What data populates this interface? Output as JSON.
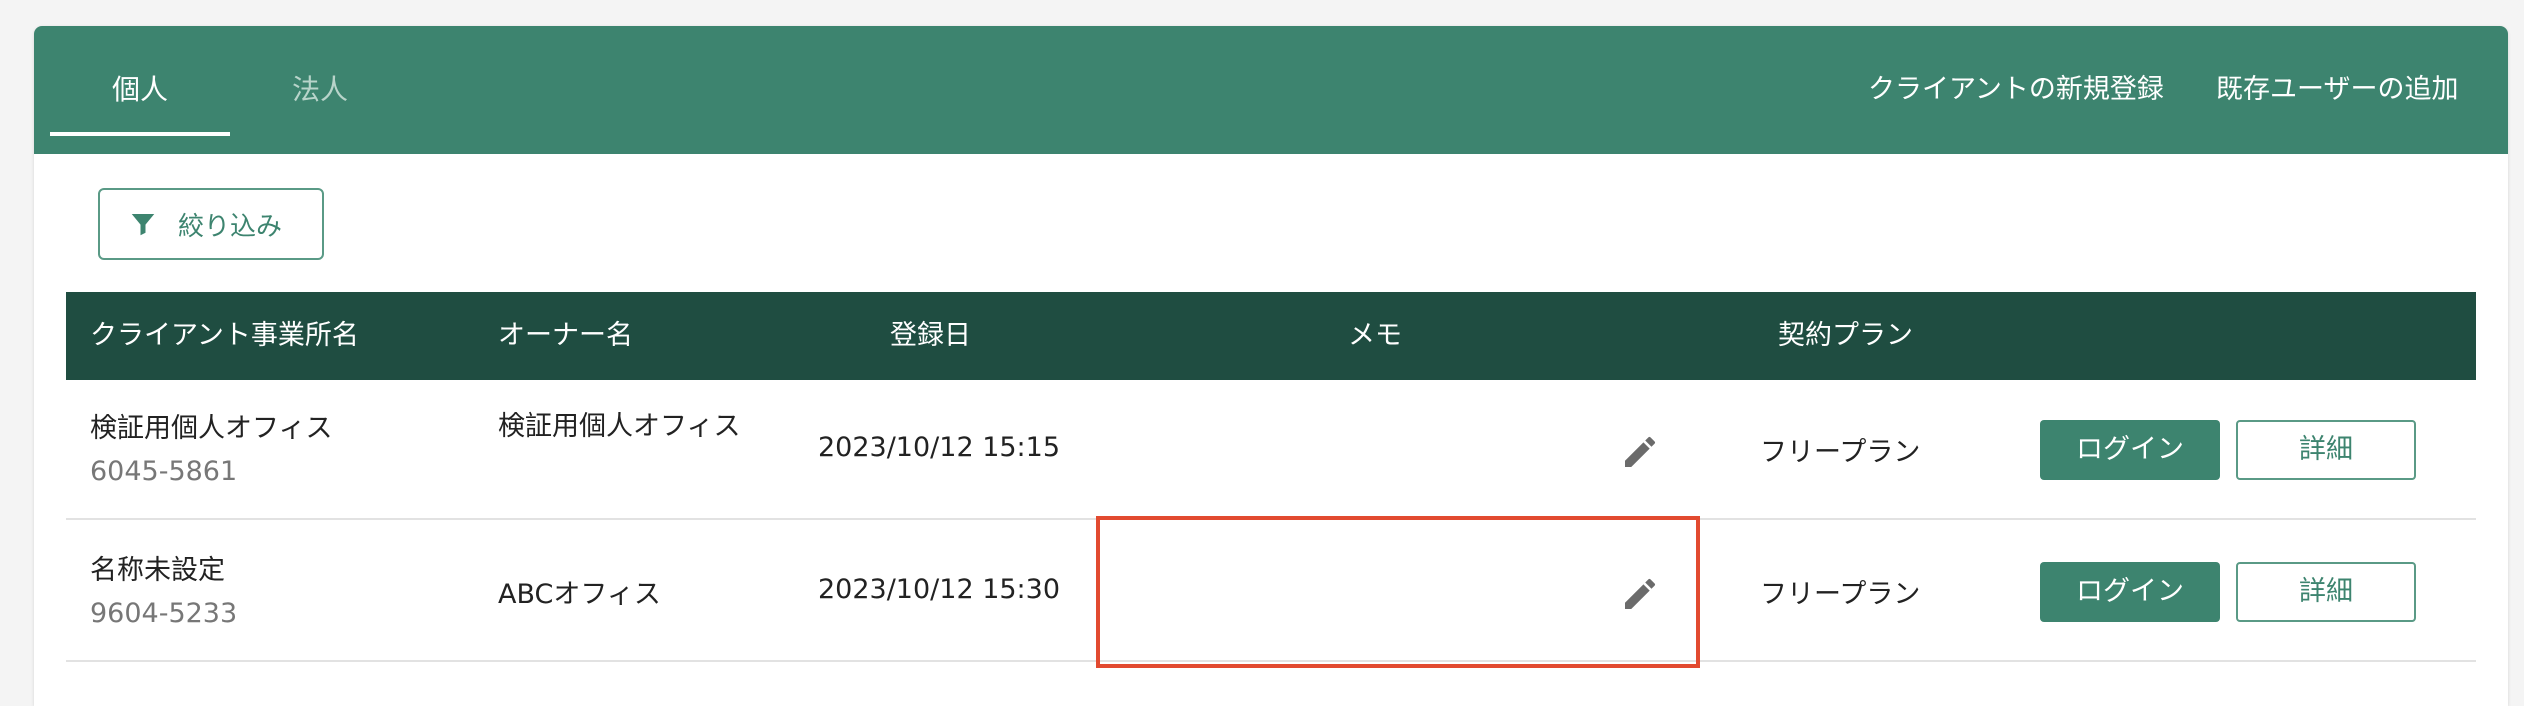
{
  "tabs": [
    {
      "label": "個人",
      "active": true
    },
    {
      "label": "法人",
      "active": false
    }
  ],
  "header_actions": {
    "new_client": "クライアントの新規登録",
    "add_user": "既存ユーザーの追加"
  },
  "filter": {
    "label": "絞り込み",
    "icon": "filter-icon"
  },
  "table": {
    "columns": [
      "クライアント事業所名",
      "オーナー名",
      "登録日",
      "メモ",
      "契約プラン"
    ],
    "rows": [
      {
        "office_name": "検証用個人オフィス",
        "office_code": "6045-5861",
        "owner": "検証用個人オフィス",
        "registered": "2023/10/12 15:15",
        "memo": "",
        "plan": "フリープラン",
        "login_label": "ログイン",
        "detail_label": "詳細"
      },
      {
        "office_name": "名称未設定",
        "office_code": "9604-5233",
        "owner": "ABCオフィス",
        "registered": "2023/10/12 15:30",
        "memo": "",
        "plan": "フリープラン",
        "login_label": "ログイン",
        "detail_label": "詳細"
      }
    ]
  },
  "colors": {
    "header": "#3d846f",
    "table_header": "#1f4d41",
    "highlight": "#e24a30"
  }
}
